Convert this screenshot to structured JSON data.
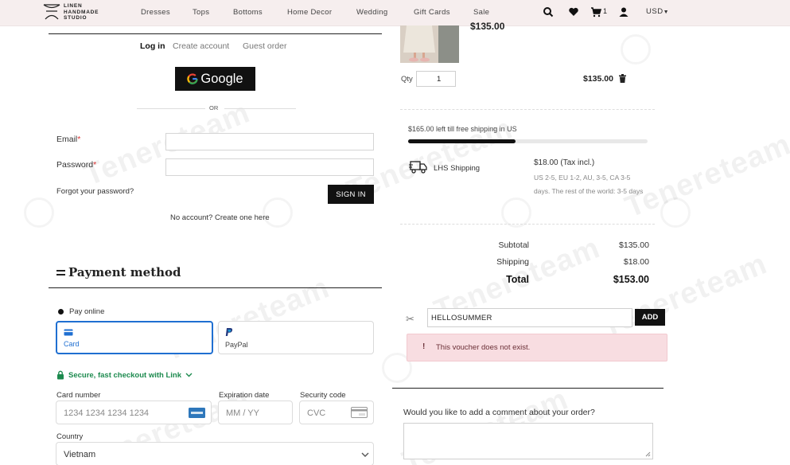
{
  "header": {
    "logo_lines": [
      "LINEN",
      "HANDMADE",
      "STUDIO"
    ],
    "nav": [
      "Dresses",
      "Tops",
      "Bottoms",
      "Home Decor",
      "Wedding",
      "Gift Cards",
      "Sale"
    ],
    "cart_count": "1",
    "currency": "USD"
  },
  "login": {
    "tabs": [
      "Log in",
      "Create account",
      "Guest order"
    ],
    "google_label": "Google",
    "or_text": "OR",
    "email_label": "Email",
    "password_label": "Password",
    "required_mark": "*",
    "forgot": "Forgot your password?",
    "signin_label": "SIGN IN",
    "no_account": "No account? Create one here"
  },
  "payment": {
    "title": "Payment method",
    "pay_online": "Pay online",
    "card_label": "Card",
    "paypal_label": "PayPal",
    "secure_link": "Secure, fast checkout with Link",
    "card_number_label": "Card number",
    "card_number_placeholder": "1234 1234 1234 1234",
    "expiry_label": "Expiration date",
    "expiry_placeholder": "MM / YY",
    "cvc_label": "Security code",
    "cvc_placeholder": "CVC",
    "country_label": "Country",
    "country_value": "Vietnam"
  },
  "cart": {
    "item_price_top": "$135.00",
    "qty_label": "Qty",
    "qty_value": "1",
    "line_price": "$135.00",
    "free_shipping": "$165.00 left till free shipping in US",
    "free_shipping_progress": 0.45,
    "shipping_name": "LHS Shipping",
    "shipping_price": "$18.00 (Tax incl.)",
    "shipping_detail": "US 2-5, EU 1-2, AU, 3-5, CA 3-5 days. The rest of the world: 3-5 days",
    "subtotal_label": "Subtotal",
    "subtotal_value": "$135.00",
    "shipping_label": "Shipping",
    "shipping_value": "$18.00",
    "total_label": "Total",
    "total_value": "$153.00"
  },
  "voucher": {
    "code": "HELLOSUMMER",
    "add_label": "ADD",
    "error": "This voucher does not exist.",
    "error_icon": "!"
  },
  "comment": {
    "question": "Would you like to add a comment about your order?"
  },
  "watermark": "Tenereteam",
  "colors": {
    "accent_blue": "#1f6fd1",
    "link_green": "#1c8a4e",
    "error_bg": "#f8dde1",
    "header_bg": "#f6eeee"
  }
}
